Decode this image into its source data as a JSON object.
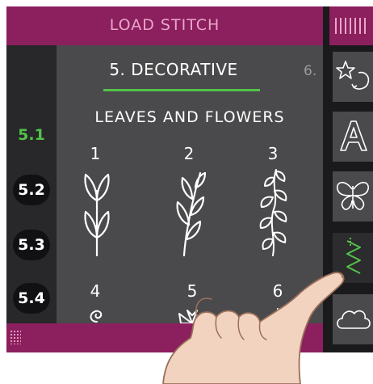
{
  "header": {
    "title": "LOAD STITCH"
  },
  "menu": {
    "current_tab": "5. DECORATIVE",
    "next_tab": "6."
  },
  "sub_categories": [
    {
      "label": "5.1",
      "active": true
    },
    {
      "label": "5.2",
      "active": false
    },
    {
      "label": "5.3",
      "active": false
    },
    {
      "label": "5.4",
      "active": false
    }
  ],
  "category": {
    "title": "LEAVES AND FLOWERS"
  },
  "stitches": [
    {
      "number": "1",
      "icon": "leaf-branch-icon"
    },
    {
      "number": "2",
      "icon": "leaf-branch-icon"
    },
    {
      "number": "3",
      "icon": "leaf-cluster-icon"
    },
    {
      "number": "4",
      "icon": "swirl-icon"
    },
    {
      "number": "5",
      "icon": "flower-icon"
    },
    {
      "number": "6",
      "icon": "leaf-icon"
    }
  ],
  "right_toolbar": [
    {
      "icon": "stitch-bars-icon",
      "active": false
    },
    {
      "icon": "stars-icon",
      "active": false
    },
    {
      "icon": "font-a-icon",
      "active": false
    },
    {
      "icon": "butterfly-icon",
      "active": false
    },
    {
      "icon": "zigzag-stitch-icon",
      "active": true
    },
    {
      "icon": "cloud-icon",
      "active": false
    }
  ],
  "colors": {
    "accent_magenta": "#8c1f5d",
    "active_green": "#52c24a",
    "panel": "#4a4a4c"
  }
}
